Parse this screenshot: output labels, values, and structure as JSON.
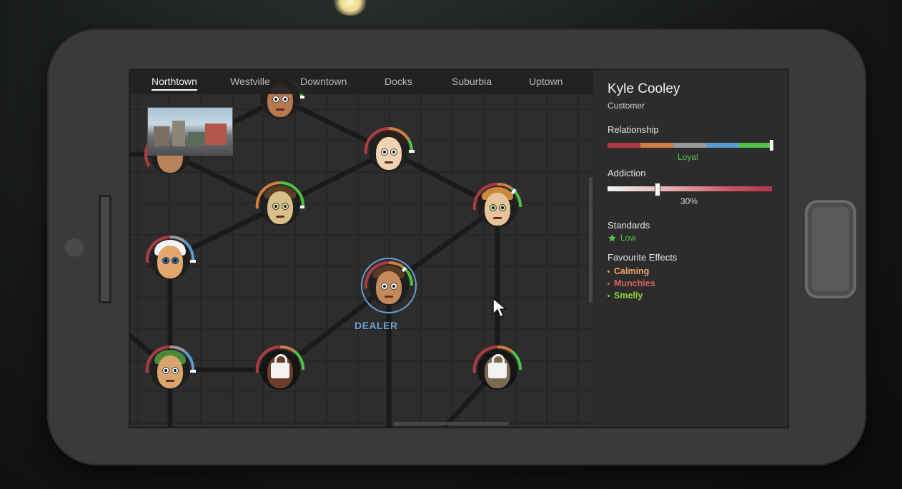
{
  "tabs": [
    {
      "label": "Northtown",
      "active": true
    },
    {
      "label": "Westville",
      "active": false
    },
    {
      "label": "Downtown",
      "active": false
    },
    {
      "label": "Docks",
      "active": false
    },
    {
      "label": "Suburbia",
      "active": false
    },
    {
      "label": "Uptown",
      "active": false
    }
  ],
  "dealer_label": "DEALER",
  "customer": {
    "name": "Kyle Cooley",
    "role": "Customer",
    "relationship_label": "Relationship",
    "relationship_value": "Loyal",
    "relationship_level": 1.0,
    "relationship_colors": [
      "#b03a44",
      "#d07d3e",
      "#9a9a9a",
      "#5a9bd0",
      "#4fc244"
    ],
    "addiction_label": "Addiction",
    "addiction_value": "30%",
    "addiction_level": 0.3,
    "standards_label": "Standards",
    "standards_value": "Low",
    "favourite_effects_label": "Favourite Effects",
    "favourite_effects": [
      {
        "name": "Calming",
        "color": "#f0a36a"
      },
      {
        "name": "Munchies",
        "color": "#d9605a"
      },
      {
        "name": "Smelly",
        "color": "#8cd13f"
      }
    ]
  },
  "icons": {
    "standards": "star-icon",
    "cursor": "mouse-pointer-icon",
    "lock": "lock-icon"
  }
}
